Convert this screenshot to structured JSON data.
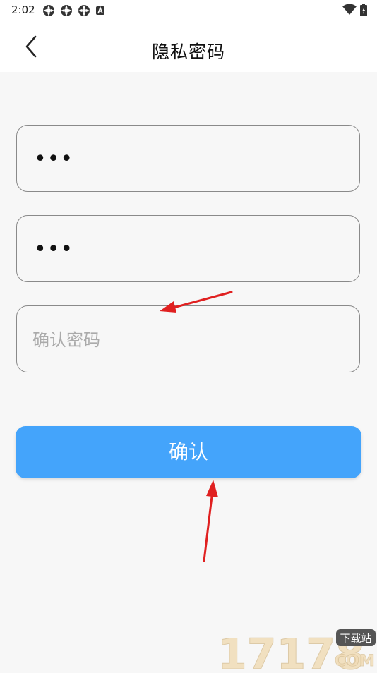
{
  "status_bar": {
    "time": "2:02",
    "notification_icons": [
      "app-icon",
      "app-icon",
      "app-icon",
      "a-icon"
    ],
    "right_icons": [
      "wifi-icon",
      "battery-icon"
    ]
  },
  "header": {
    "title": "隐私密码",
    "back_icon": "chevron-left-icon"
  },
  "form": {
    "field1": {
      "masked_value": "•••"
    },
    "field2": {
      "masked_value": "•••"
    },
    "field3": {
      "value": "",
      "placeholder": "确认密码"
    },
    "confirm_label": "确认"
  },
  "colors": {
    "accent": "#44a4fb",
    "annotation_arrow": "#e02020",
    "background": "#f7f7f7"
  },
  "watermark": {
    "number": "17178",
    "tag": "下载站",
    "domain": "COM"
  }
}
